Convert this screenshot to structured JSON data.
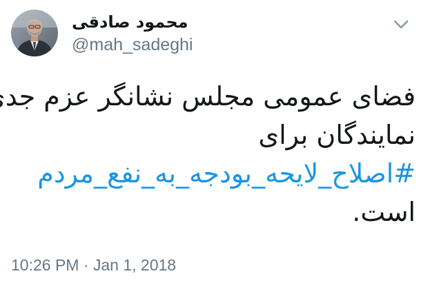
{
  "author": {
    "display_name": "محمود صادقی",
    "handle": "@mah_sadeghi",
    "avatar_icon": "profile-photo"
  },
  "menu": {
    "icon": "chevron-down-icon"
  },
  "tweet": {
    "line1": "فضای عمومی مجلس نشانگر عزم جدی",
    "line2": "نمایندگان برای",
    "hashtag": "#اصلاح_لایحه_بودجه_به_نفع_مردم",
    "line4": "است.",
    "hashtag_color": "#1b95e0"
  },
  "meta": {
    "timestamp": "10:26 PM · Jan 1, 2018"
  }
}
